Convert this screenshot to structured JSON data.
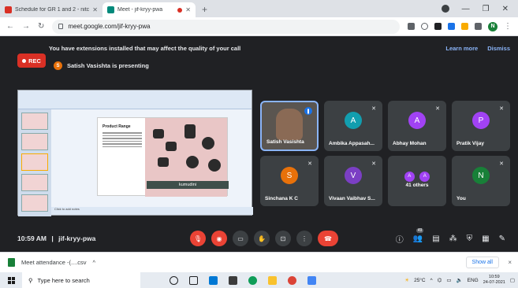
{
  "browser": {
    "tabs": [
      {
        "title": "Schedule for GR 1 and 2 - nitc@...",
        "active": false,
        "favicon_color": "#d93025"
      },
      {
        "title": "Meet - jif-kryy-pwa",
        "active": true,
        "favicon_color": "#00897b"
      }
    ],
    "new_tab": "+",
    "url": "meet.google.com/jif-kryy-pwa",
    "profile_initial": "N"
  },
  "meet": {
    "banner_text": "You have extensions installed that may affect the quality of your call",
    "banner_learn_more": "Learn more",
    "banner_dismiss": "Dismiss",
    "rec_label": "REC",
    "presenter_initial": "S",
    "presenting_text": "Satish Vasishta is presenting",
    "slide": {
      "title": "Product Range",
      "brand": "kumudini",
      "status": "Click to add notes"
    },
    "tiles": [
      {
        "name": "Satish Vasishta",
        "type": "video"
      },
      {
        "name": "Ambika Appasah...",
        "initial": "A",
        "color": "#129eaf"
      },
      {
        "name": "Abhay Mohan",
        "initial": "A",
        "color": "#a142f4"
      },
      {
        "name": "Pratik Vijay",
        "initial": "P",
        "color": "#a142f4"
      },
      {
        "name": "Sinchana K C",
        "initial": "S",
        "color": "#e8710a"
      },
      {
        "name": "Vivaan Vaibhav S...",
        "initial": "V",
        "color": "#7b3fc4"
      },
      {
        "name": "41 others",
        "initials": [
          "A",
          "A"
        ],
        "color": "#a142f4"
      },
      {
        "name": "You",
        "initial": "N",
        "color": "#188038"
      }
    ],
    "clock": "10:59 AM",
    "separator": "|",
    "meeting_code": "jif-kryy-pwa",
    "participant_count": "49"
  },
  "download": {
    "filename": "Meet attendance -(....csv",
    "chevron": "^",
    "show_all": "Show all",
    "close": "×"
  },
  "taskbar": {
    "search_placeholder": "Type here to search",
    "weather": "25°C",
    "lang": "ENG",
    "time": "10:59",
    "date": "24-07-2021"
  }
}
